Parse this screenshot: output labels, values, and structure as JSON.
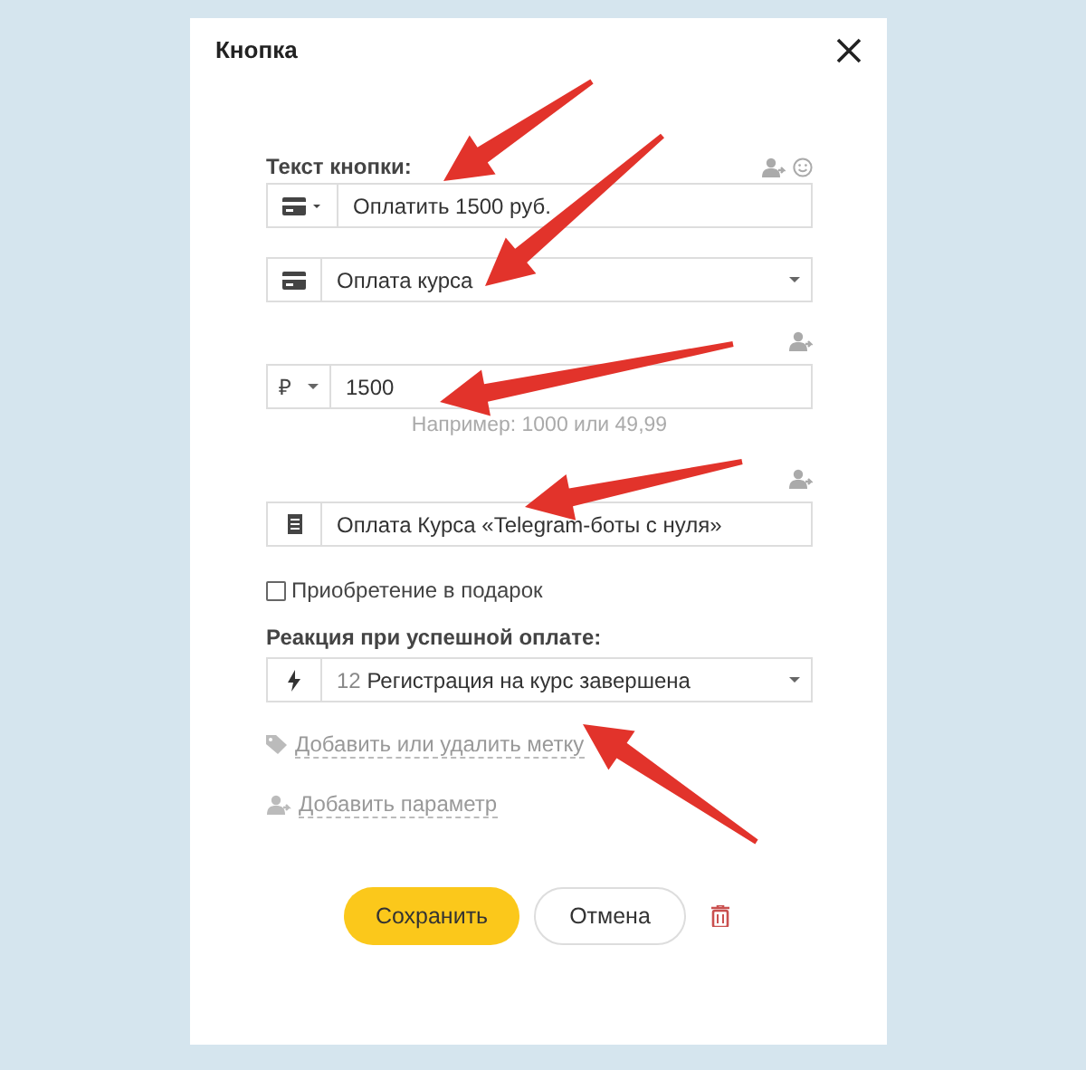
{
  "dialog": {
    "title": "Кнопка"
  },
  "button_text": {
    "label": "Текст кнопки:",
    "value": "Оплатить 1500 руб."
  },
  "payment_type": {
    "value": "Оплата курса"
  },
  "amount": {
    "currency": "₽",
    "value": "1500",
    "hint": "Например: 1000 или 49,99"
  },
  "description": {
    "value": "Оплата Курса «Telegram-боты с нуля»"
  },
  "gift": {
    "label": "Приобретение в подарок",
    "checked": false
  },
  "reaction": {
    "label": "Реакция при успешной оплате:",
    "number": "12",
    "value": "Регистрация на курс завершена"
  },
  "links": [
    {
      "kind": "tag",
      "label": "Добавить или удалить метку"
    },
    {
      "kind": "parameter",
      "label": "Добавить параметр"
    }
  ],
  "buttons": {
    "save": "Сохранить",
    "cancel": "Отмена"
  }
}
